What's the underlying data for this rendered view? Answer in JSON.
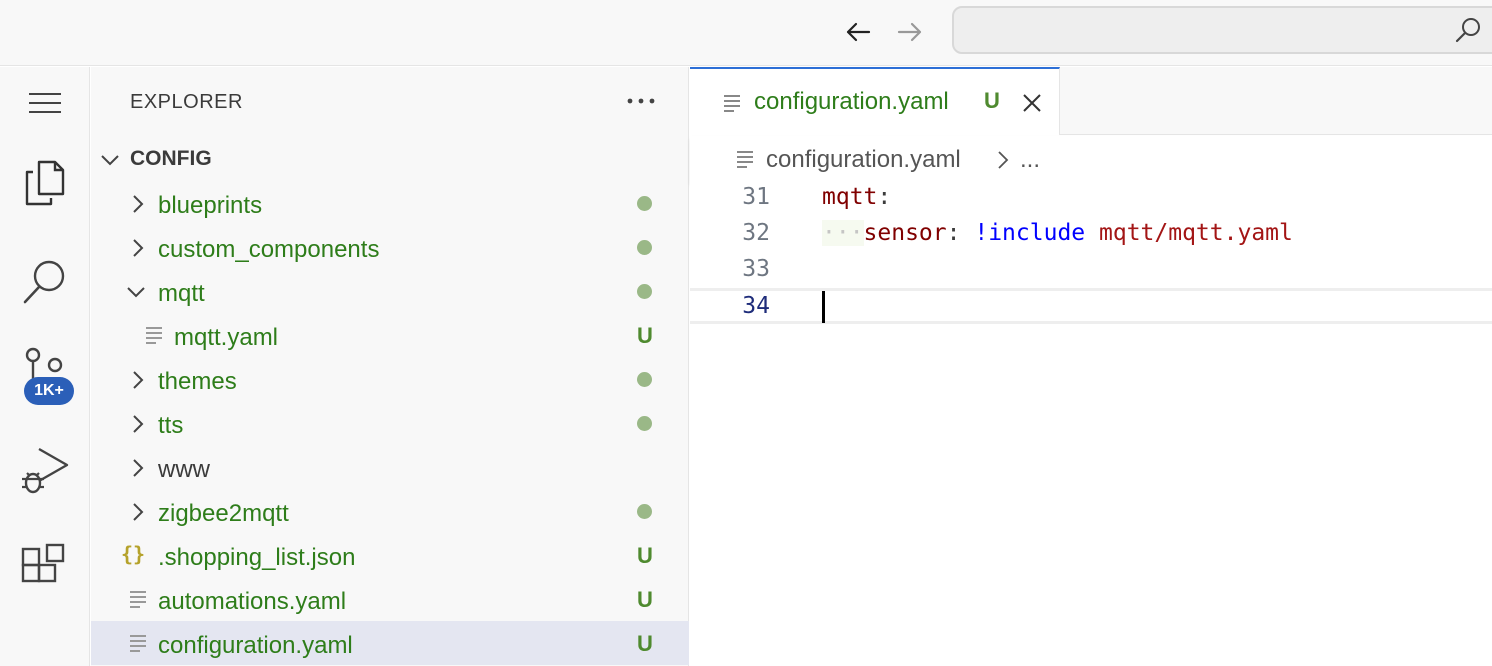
{
  "titlebar": {
    "back_icon": "arrow-left-icon",
    "forward_icon": "arrow-right-icon",
    "search_icon": "search-icon",
    "command_center_value": ""
  },
  "activitybar": {
    "items": [
      {
        "name": "menu",
        "icon": "hamburger-icon"
      },
      {
        "name": "explorer",
        "icon": "files-icon"
      },
      {
        "name": "search",
        "icon": "search-icon"
      },
      {
        "name": "source-control",
        "icon": "source-control-icon",
        "badge": "1K+"
      },
      {
        "name": "run-debug",
        "icon": "run-debug-icon"
      },
      {
        "name": "extensions",
        "icon": "extensions-icon"
      }
    ]
  },
  "sidebar": {
    "title": "EXPLORER",
    "more_icon": "ellipsis-icon",
    "folder": "CONFIG",
    "tree": [
      {
        "label": "blueprints",
        "type": "folder",
        "expanded": false,
        "status": "dot",
        "indent": 0
      },
      {
        "label": "custom_components",
        "type": "folder",
        "expanded": false,
        "status": "dot",
        "indent": 0
      },
      {
        "label": "mqtt",
        "type": "folder",
        "expanded": true,
        "status": "dot",
        "indent": 0
      },
      {
        "label": "mqtt.yaml",
        "type": "file",
        "status": "U",
        "indent": 1
      },
      {
        "label": "themes",
        "type": "folder",
        "expanded": false,
        "status": "dot",
        "indent": 0
      },
      {
        "label": "tts",
        "type": "folder",
        "expanded": false,
        "status": "dot",
        "indent": 0
      },
      {
        "label": "www",
        "type": "folder",
        "expanded": false,
        "status": "",
        "indent": 0
      },
      {
        "label": "zigbee2mqtt",
        "type": "folder",
        "expanded": false,
        "status": "dot",
        "indent": 0
      },
      {
        "label": ".shopping_list.json",
        "type": "json",
        "status": "U",
        "indent": 0
      },
      {
        "label": "automations.yaml",
        "type": "file",
        "status": "U",
        "indent": 0
      },
      {
        "label": "configuration.yaml",
        "type": "file",
        "status": "U",
        "indent": 0,
        "selected": true
      }
    ]
  },
  "editor": {
    "tab": {
      "label": "configuration.yaml",
      "status": "U",
      "close_icon": "close-icon"
    },
    "breadcrumb": {
      "file": "configuration.yaml",
      "more": "..."
    },
    "lines": [
      {
        "number": "31",
        "key": "mqtt",
        "colon": ":"
      },
      {
        "number": "32",
        "indent": "···",
        "key": "sensor",
        "colon": ":",
        "tag": "!include",
        "value": "mqtt/mqtt.yaml"
      },
      {
        "number": "33"
      },
      {
        "number": "34",
        "current": true
      }
    ]
  },
  "colors": {
    "accent": "#2d6fd6",
    "untracked_green": "#2e7d1a",
    "badge_blue": "#2b5fb8",
    "selected_row": "#e4e6f1"
  }
}
